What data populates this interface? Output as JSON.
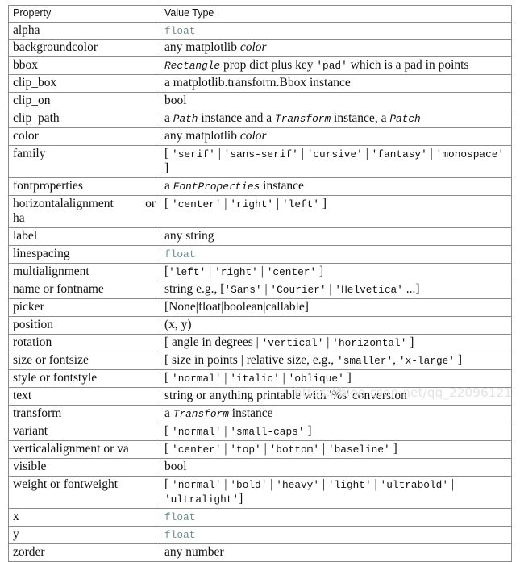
{
  "table": {
    "columns": [
      "Property",
      "Value Type"
    ],
    "rows": [
      {
        "property": "alpha",
        "value_text": "float",
        "value_parts": [
          {
            "t": "float",
            "s": "float"
          }
        ]
      },
      {
        "property": "backgroundcolor",
        "value_text": "any matplotlib color",
        "value_parts": [
          {
            "t": "any matplotlib ",
            "s": "plain"
          },
          {
            "t": "color",
            "s": "serif-italic"
          }
        ]
      },
      {
        "property": "bbox",
        "value_text": "Rectangle prop dict plus key 'pad' which is a pad in points",
        "value_parts": [
          {
            "t": "Rectangle",
            "s": "mono-italic"
          },
          {
            "t": " prop dict plus key ",
            "s": "plain"
          },
          {
            "t": "'pad'",
            "s": "mono"
          },
          {
            "t": " which is a pad in points",
            "s": "plain"
          }
        ]
      },
      {
        "property": "clip_box",
        "value_text": "a matplotlib.transform.Bbox instance",
        "value_parts": [
          {
            "t": "a matplotlib.transform.Bbox instance",
            "s": "plain"
          }
        ]
      },
      {
        "property": "clip_on",
        "value_text": "bool",
        "value_parts": [
          {
            "t": "bool",
            "s": "plain"
          }
        ]
      },
      {
        "property": "clip_path",
        "value_text": "a Path instance and a Transform instance, a Patch",
        "value_parts": [
          {
            "t": "a ",
            "s": "plain"
          },
          {
            "t": "Path",
            "s": "mono-italic"
          },
          {
            "t": " instance and a ",
            "s": "plain"
          },
          {
            "t": "Transform",
            "s": "mono-italic"
          },
          {
            "t": " instance, a ",
            "s": "plain"
          },
          {
            "t": "Patch",
            "s": "mono-italic"
          }
        ]
      },
      {
        "property": "color",
        "value_text": "any matplotlib color",
        "value_parts": [
          {
            "t": "any matplotlib ",
            "s": "plain"
          },
          {
            "t": "color",
            "s": "serif-italic"
          }
        ]
      },
      {
        "property": "family",
        "value_text": "[ 'serif' | 'sans-serif' | 'cursive' | 'fantasy' | 'monospace' ]",
        "value_parts": [
          {
            "t": "[ ",
            "s": "plain"
          },
          {
            "t": "'serif'",
            "s": "mono"
          },
          {
            "t": " | ",
            "s": "plain"
          },
          {
            "t": "'sans-serif'",
            "s": "mono"
          },
          {
            "t": " | ",
            "s": "plain"
          },
          {
            "t": "'cursive'",
            "s": "mono"
          },
          {
            "t": " | ",
            "s": "plain"
          },
          {
            "t": "'fantasy'",
            "s": "mono"
          },
          {
            "t": " | ",
            "s": "plain"
          },
          {
            "t": "'monospace'",
            "s": "mono"
          },
          {
            "t": " ]",
            "s": "plain"
          }
        ]
      },
      {
        "property": "fontproperties",
        "value_text": "a FontProperties instance",
        "value_parts": [
          {
            "t": "a ",
            "s": "plain"
          },
          {
            "t": "FontProperties",
            "s": "mono-italic"
          },
          {
            "t": " instance",
            "s": "plain"
          }
        ]
      },
      {
        "property": "horizontalalignment or ha",
        "property_line1": "horizontalalignment or",
        "property_line2": "ha",
        "justified": true,
        "value_text": "[ 'center' | 'right' | 'left' ]",
        "value_parts": [
          {
            "t": "[ ",
            "s": "plain"
          },
          {
            "t": "'center'",
            "s": "mono"
          },
          {
            "t": " | ",
            "s": "plain"
          },
          {
            "t": "'right'",
            "s": "mono"
          },
          {
            "t": " | ",
            "s": "plain"
          },
          {
            "t": "'left'",
            "s": "mono"
          },
          {
            "t": " ]",
            "s": "plain"
          }
        ]
      },
      {
        "property": "label",
        "value_text": "any string",
        "value_parts": [
          {
            "t": "any string",
            "s": "plain"
          }
        ]
      },
      {
        "property": "linespacing",
        "value_text": "float",
        "value_parts": [
          {
            "t": "float",
            "s": "float"
          }
        ]
      },
      {
        "property": "multialignment",
        "value_text": "['left' | 'right' | 'center' ]",
        "value_parts": [
          {
            "t": "[",
            "s": "plain"
          },
          {
            "t": "'left'",
            "s": "mono"
          },
          {
            "t": " | ",
            "s": "plain"
          },
          {
            "t": "'right'",
            "s": "mono"
          },
          {
            "t": " | ",
            "s": "plain"
          },
          {
            "t": "'center'",
            "s": "mono"
          },
          {
            "t": " ]",
            "s": "plain"
          }
        ]
      },
      {
        "property": "name or fontname",
        "value_text": "string e.g., ['Sans' | 'Courier' | 'Helvetica' ...]",
        "value_parts": [
          {
            "t": "string e.g., [",
            "s": "plain"
          },
          {
            "t": "'Sans'",
            "s": "mono"
          },
          {
            "t": " | ",
            "s": "plain"
          },
          {
            "t": "'Courier'",
            "s": "mono"
          },
          {
            "t": " | ",
            "s": "plain"
          },
          {
            "t": "'Helvetica'",
            "s": "mono"
          },
          {
            "t": " ...]",
            "s": "plain"
          }
        ]
      },
      {
        "property": "picker",
        "value_text": "[None|float|boolean|callable]",
        "value_parts": [
          {
            "t": "[None|float|boolean|callable]",
            "s": "plain"
          }
        ]
      },
      {
        "property": "position",
        "value_text": "(x, y)",
        "value_parts": [
          {
            "t": "(x, y)",
            "s": "plain"
          }
        ]
      },
      {
        "property": "rotation",
        "value_text": "[ angle in degrees | 'vertical' | 'horizontal' ]",
        "value_parts": [
          {
            "t": "[ angle in degrees | ",
            "s": "plain"
          },
          {
            "t": "'vertical'",
            "s": "mono"
          },
          {
            "t": " | ",
            "s": "plain"
          },
          {
            "t": "'horizontal'",
            "s": "mono"
          },
          {
            "t": " ]",
            "s": "plain"
          }
        ]
      },
      {
        "property": "size or fontsize",
        "value_text": "[ size in points | relative size, e.g., 'smaller', 'x-large' ]",
        "value_parts": [
          {
            "t": "[ size in points | relative size, e.g., ",
            "s": "plain"
          },
          {
            "t": "'smaller'",
            "s": "mono"
          },
          {
            "t": ", ",
            "s": "plain"
          },
          {
            "t": "'x-large'",
            "s": "mono"
          },
          {
            "t": " ]",
            "s": "plain"
          }
        ]
      },
      {
        "property": "style or fontstyle",
        "value_text": "[ 'normal' | 'italic' | 'oblique' ]",
        "value_parts": [
          {
            "t": "[ ",
            "s": "plain"
          },
          {
            "t": "'normal'",
            "s": "mono"
          },
          {
            "t": " | ",
            "s": "plain"
          },
          {
            "t": "'italic'",
            "s": "mono"
          },
          {
            "t": " | ",
            "s": "plain"
          },
          {
            "t": "'oblique'",
            "s": "mono"
          },
          {
            "t": " ]",
            "s": "plain"
          }
        ]
      },
      {
        "property": "text",
        "value_text": "string or anything printable with '%s' conversion",
        "value_parts": [
          {
            "t": "string or anything printable with '%s' conversion",
            "s": "plain"
          }
        ]
      },
      {
        "property": "transform",
        "value_text": "a Transform instance",
        "value_parts": [
          {
            "t": "a ",
            "s": "plain"
          },
          {
            "t": "Transform",
            "s": "mono-italic"
          },
          {
            "t": " instance",
            "s": "plain"
          }
        ]
      },
      {
        "property": "variant",
        "value_text": "[ 'normal' | 'small-caps' ]",
        "value_parts": [
          {
            "t": "[ ",
            "s": "plain"
          },
          {
            "t": "'normal'",
            "s": "mono"
          },
          {
            "t": " | ",
            "s": "plain"
          },
          {
            "t": "'small-caps'",
            "s": "mono"
          },
          {
            "t": " ]",
            "s": "plain"
          }
        ]
      },
      {
        "property": "verticalalignment or va",
        "value_text": "[ 'center' | 'top' | 'bottom' | 'baseline' ]",
        "value_parts": [
          {
            "t": "[ ",
            "s": "plain"
          },
          {
            "t": "'center'",
            "s": "mono"
          },
          {
            "t": " | ",
            "s": "plain"
          },
          {
            "t": "'top'",
            "s": "mono"
          },
          {
            "t": " | ",
            "s": "plain"
          },
          {
            "t": "'bottom'",
            "s": "mono"
          },
          {
            "t": " | ",
            "s": "plain"
          },
          {
            "t": "'baseline'",
            "s": "mono"
          },
          {
            "t": " ]",
            "s": "plain"
          }
        ]
      },
      {
        "property": "visible",
        "value_text": "bool",
        "value_parts": [
          {
            "t": "bool",
            "s": "plain"
          }
        ]
      },
      {
        "property": "weight or fontweight",
        "value_text": "[ 'normal' | 'bold' | 'heavy' | 'light' | 'ultrabold' | 'ultralight']",
        "value_parts": [
          {
            "t": "[ ",
            "s": "plain"
          },
          {
            "t": "'normal'",
            "s": "mono"
          },
          {
            "t": " | ",
            "s": "plain"
          },
          {
            "t": "'bold'",
            "s": "mono"
          },
          {
            "t": " | ",
            "s": "plain"
          },
          {
            "t": "'heavy'",
            "s": "mono"
          },
          {
            "t": " | ",
            "s": "plain"
          },
          {
            "t": "'light'",
            "s": "mono"
          },
          {
            "t": " | ",
            "s": "plain"
          },
          {
            "t": "'ultrabold'",
            "s": "mono"
          },
          {
            "t": " | ",
            "s": "plain"
          },
          {
            "t": "'ultralight'",
            "s": "mono"
          },
          {
            "t": "]",
            "s": "plain"
          }
        ]
      },
      {
        "property": "x",
        "value_text": "float",
        "value_parts": [
          {
            "t": "float",
            "s": "float"
          }
        ]
      },
      {
        "property": "y",
        "value_text": "float",
        "value_parts": [
          {
            "t": "float",
            "s": "float"
          }
        ]
      },
      {
        "property": "zorder",
        "value_text": "any number",
        "value_parts": [
          {
            "t": "any number",
            "s": "plain"
          }
        ]
      }
    ]
  },
  "watermark": {
    "text": "https://blog.csdn.net/qq_22096121",
    "color": "#e3e3e3"
  }
}
